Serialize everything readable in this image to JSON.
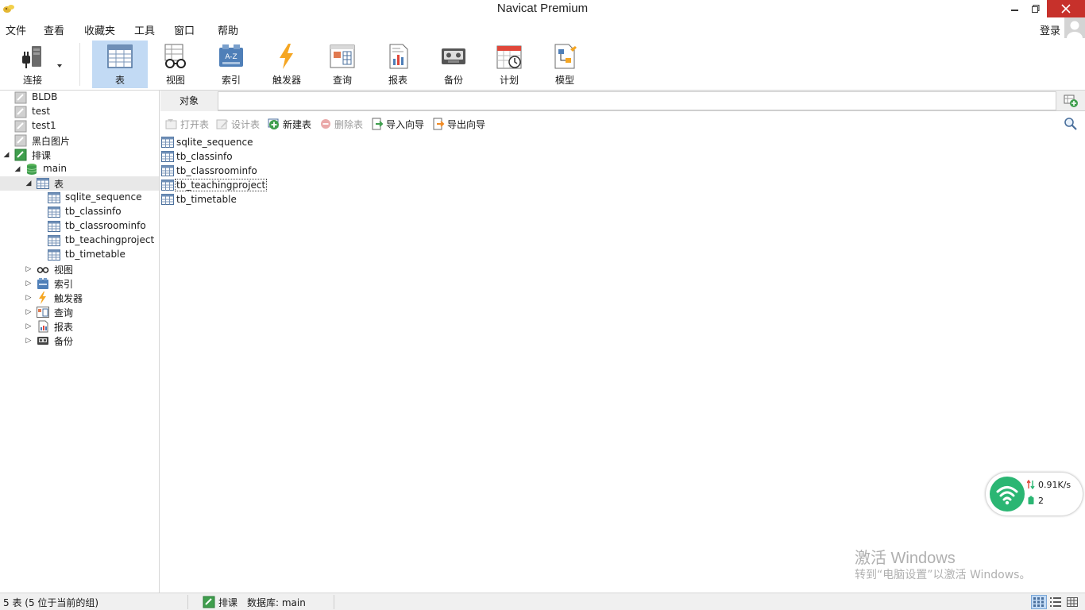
{
  "window": {
    "title": "Navicat Premium"
  },
  "menu": {
    "items": [
      "文件",
      "查看",
      "收藏夹",
      "工具",
      "窗口",
      "帮助"
    ],
    "login": "登录"
  },
  "toolbar": {
    "tools": [
      {
        "label": "连接",
        "icon": "plug-icon"
      },
      {
        "label": "表",
        "icon": "table-icon",
        "active": true
      },
      {
        "label": "视图",
        "icon": "glasses-icon"
      },
      {
        "label": "索引",
        "icon": "index-az-icon"
      },
      {
        "label": "触发器",
        "icon": "lightning-icon"
      },
      {
        "label": "查询",
        "icon": "query-icon"
      },
      {
        "label": "报表",
        "icon": "report-icon"
      },
      {
        "label": "备份",
        "icon": "backup-icon"
      },
      {
        "label": "计划",
        "icon": "calendar-clock-icon"
      },
      {
        "label": "模型",
        "icon": "model-icon"
      }
    ]
  },
  "sidebar": {
    "connections": [
      "BLDB",
      "test",
      "test1",
      "黑白图片"
    ],
    "open_connection": "排课",
    "database": "main",
    "tables_node": "表",
    "tables": [
      "sqlite_sequence",
      "tb_classinfo",
      "tb_classroominfo",
      "tb_teachingproject",
      "tb_timetable"
    ],
    "other_nodes": [
      "视图",
      "索引",
      "触发器",
      "查询",
      "报表",
      "备份"
    ]
  },
  "objects": {
    "tab_label": "对象",
    "actions": [
      {
        "label": "打开表",
        "enabled": false
      },
      {
        "label": "设计表",
        "enabled": false
      },
      {
        "label": "新建表",
        "enabled": true
      },
      {
        "label": "删除表",
        "enabled": false
      },
      {
        "label": "导入向导",
        "enabled": true
      },
      {
        "label": "导出向导",
        "enabled": true
      }
    ],
    "items": [
      "sqlite_sequence",
      "tb_classinfo",
      "tb_classroominfo",
      "tb_teachingproject",
      "tb_timetable"
    ],
    "focused_item": "tb_teachingproject"
  },
  "network_widget": {
    "speed": "0.91K/s",
    "count": "2"
  },
  "watermark": {
    "line1": "激活 Windows",
    "line2": "转到“电脑设置”以激活 Windows。"
  },
  "status": {
    "left": "5 表 (5 位于当前的组)",
    "connection": "排课",
    "database": "数据库: main"
  },
  "colors": {
    "accent_selection": "#c2daf4",
    "close_button": "#c7312b",
    "wifi_green": "#2bb673"
  }
}
